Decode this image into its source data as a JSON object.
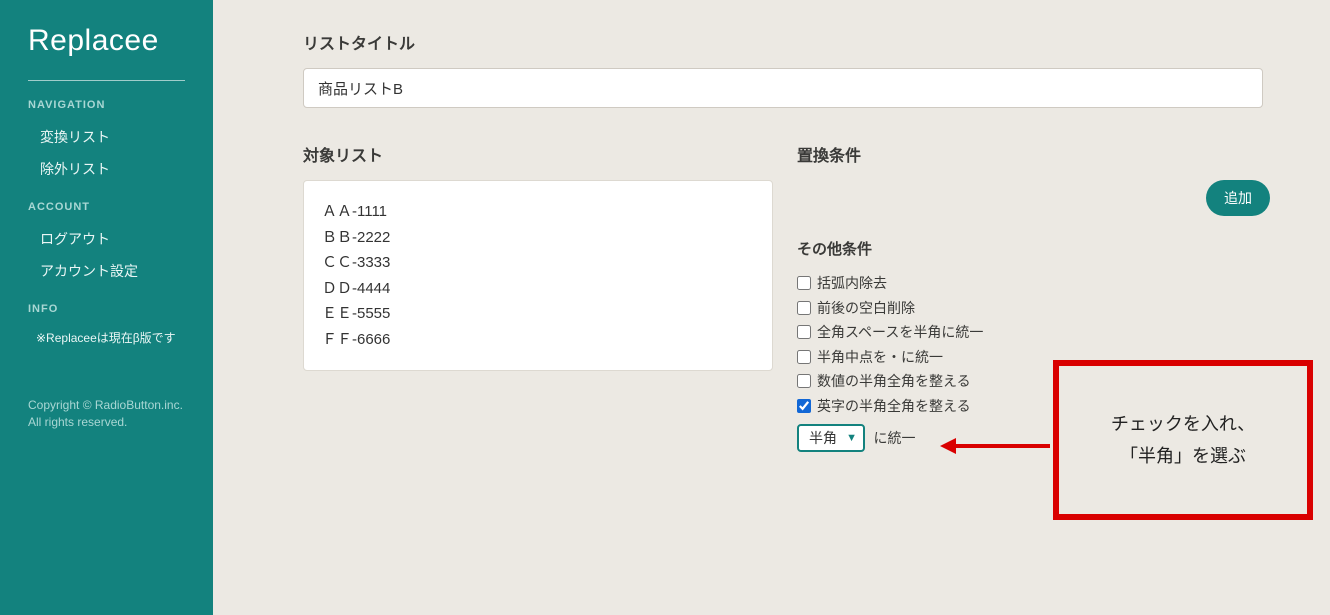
{
  "brand": "Replacee",
  "sidebar": {
    "nav_heading": "NAVIGATION",
    "nav_items": [
      "変換リスト",
      "除外リスト"
    ],
    "account_heading": "ACCOUNT",
    "account_items": [
      "ログアウト",
      "アカウント設定"
    ],
    "info_heading": "INFO",
    "info_text": "※Replaceeは現在β版です",
    "copyright": "Copyright © RadioButton.inc. All rights reserved."
  },
  "title_label": "リストタイトル",
  "title_value": "商品リストB",
  "target_label": "対象リスト",
  "target_lines": [
    "ＡＡ-1111",
    "ＢＢ-2222",
    "ＣＣ-3333",
    "ＤＤ-4444",
    "ＥＥ-5555",
    "ＦＦ-6666"
  ],
  "replace_label": "置換条件",
  "add_label": "追加",
  "other_label": "その他条件",
  "checks": {
    "c0": {
      "label": "括弧内除去",
      "checked": false
    },
    "c1": {
      "label": "前後の空白削除",
      "checked": false
    },
    "c2": {
      "label": "全角スペースを半角に統一",
      "checked": false
    },
    "c3": {
      "label": "半角中点を・に統一",
      "checked": false
    },
    "c4": {
      "label": "数値の半角全角を整える",
      "checked": false
    },
    "c5": {
      "label": "英字の半角全角を整える",
      "checked": true
    }
  },
  "select_value": "半角",
  "select_tail": "に統一",
  "callout_line1": "チェックを入れ、",
  "callout_line2": "「半角」を選ぶ"
}
